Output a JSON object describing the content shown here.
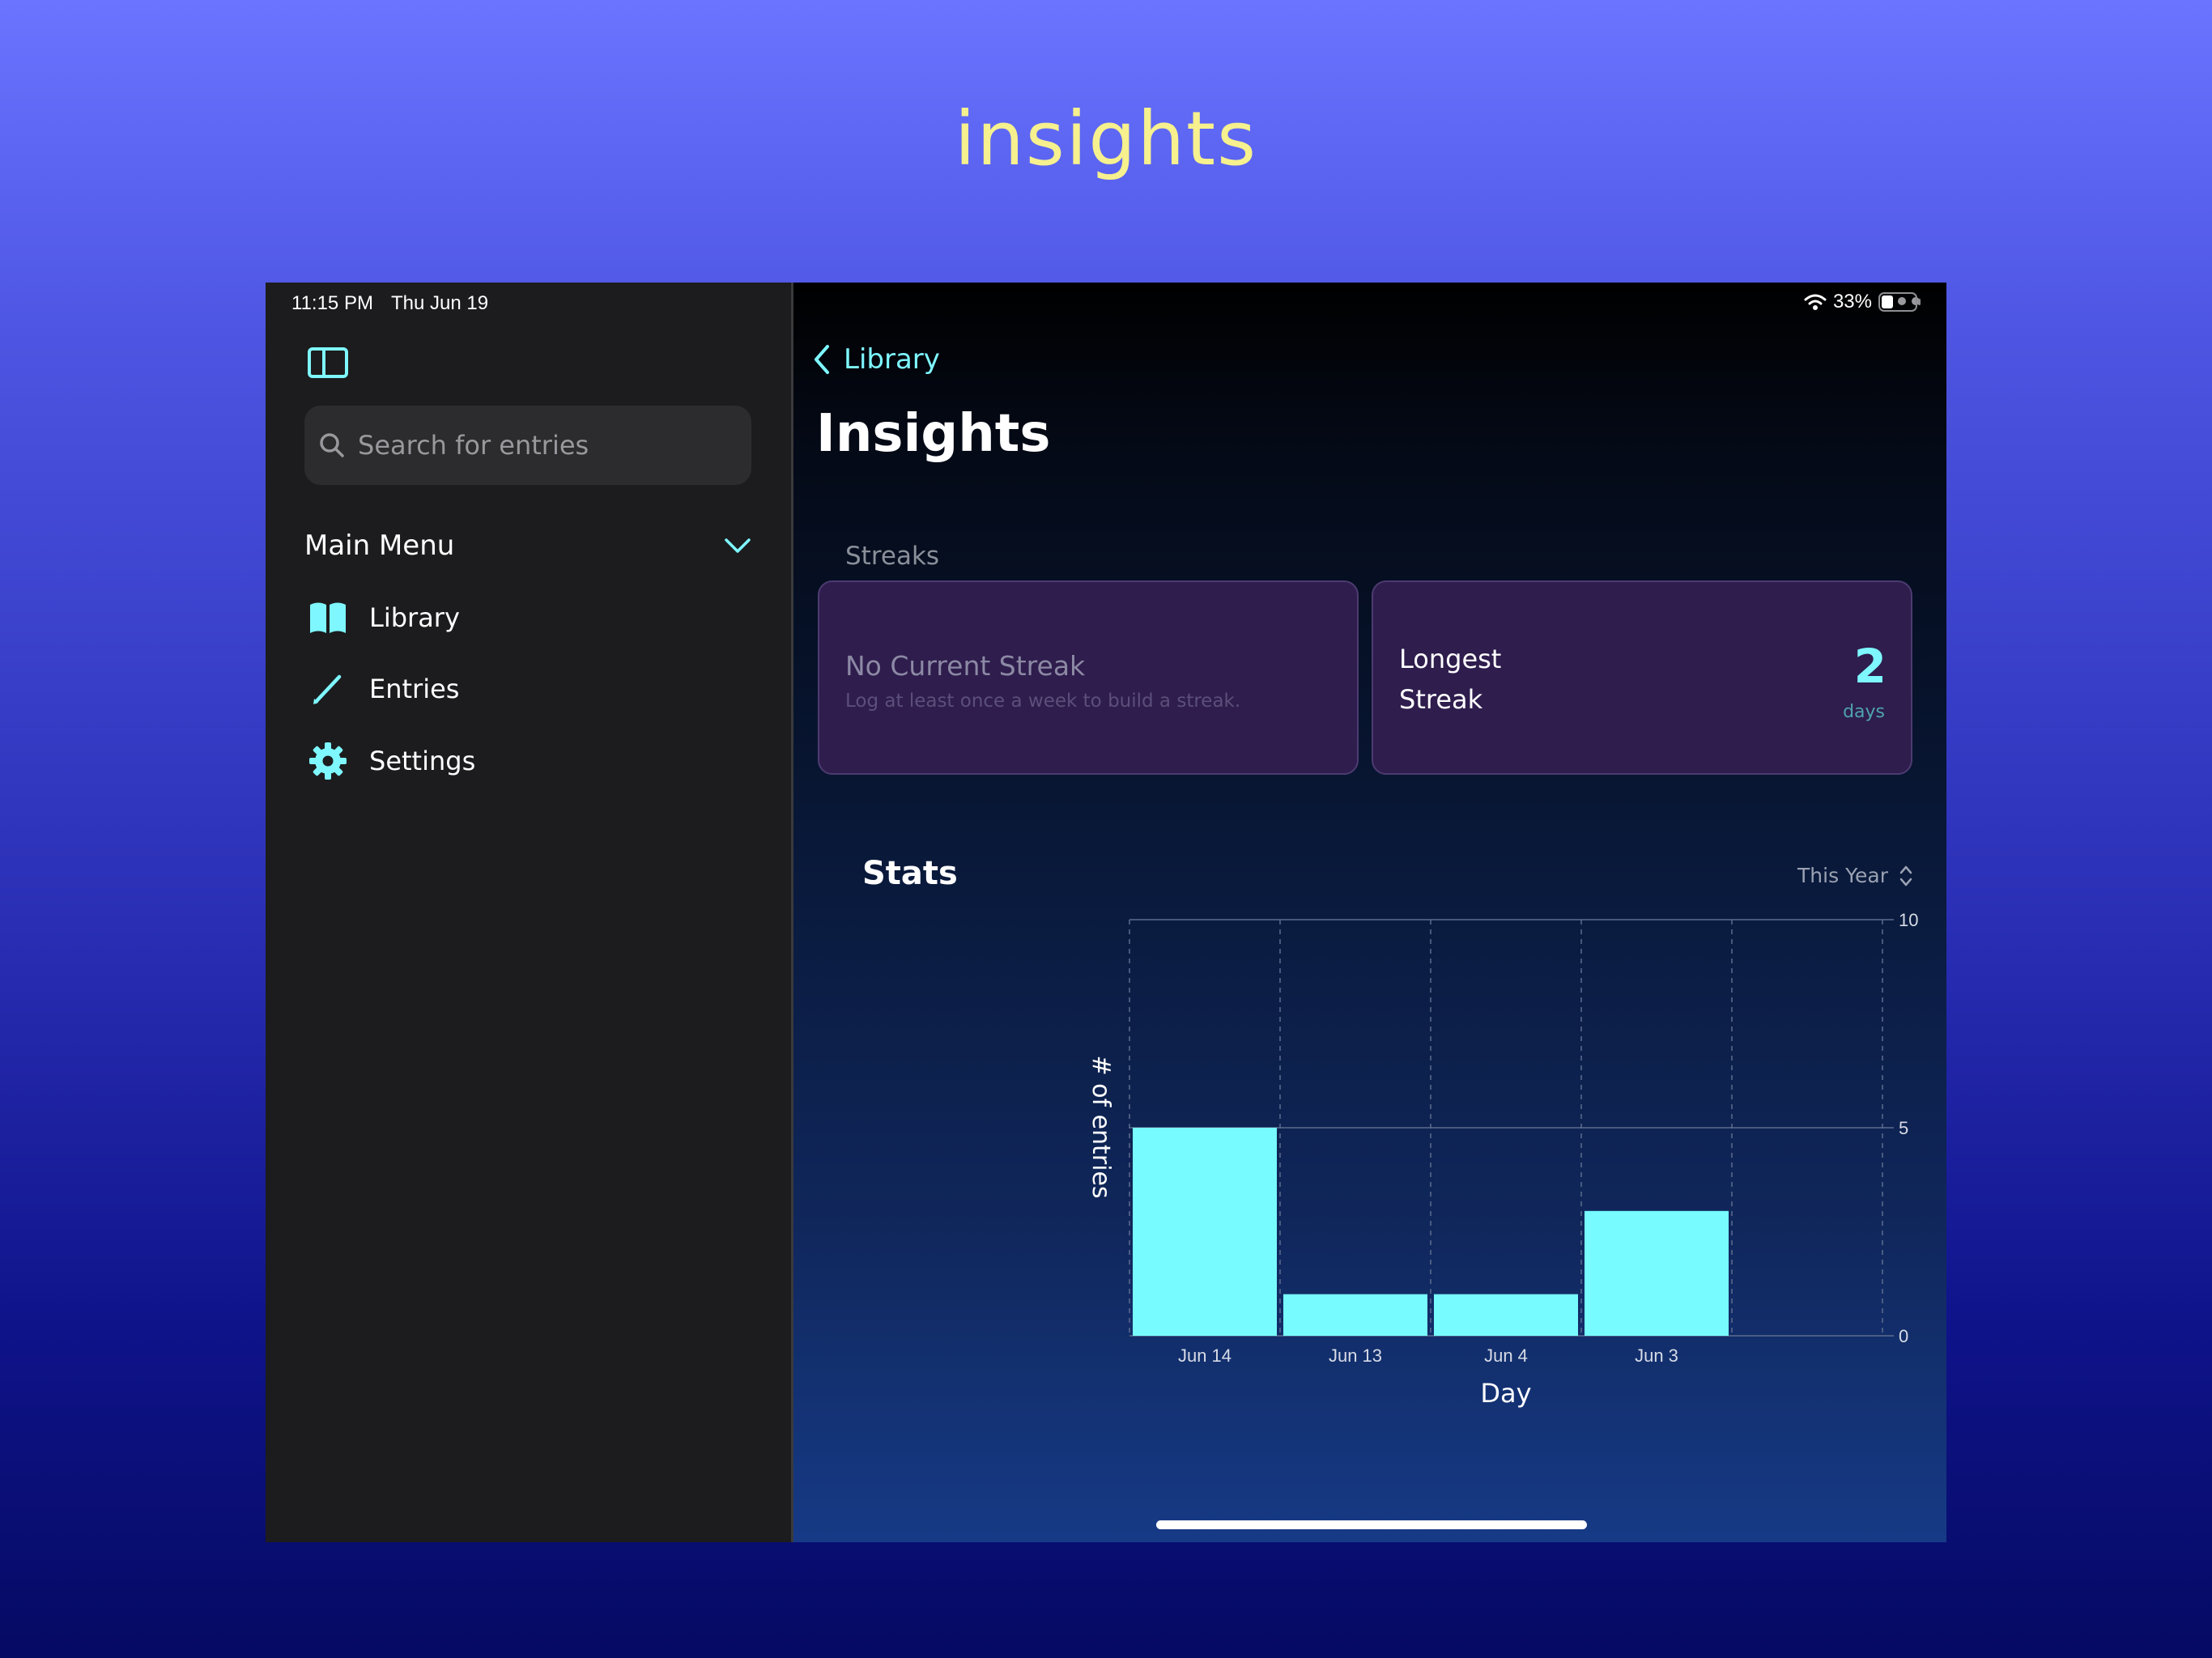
{
  "promo": {
    "title": "insights"
  },
  "status_bar": {
    "time": "11:15 PM",
    "date": "Thu Jun 19",
    "battery": "33%"
  },
  "sidebar": {
    "search": {
      "placeholder": "Search for entries",
      "value": ""
    },
    "menu_header": "Main Menu",
    "items": [
      {
        "label": "Library",
        "icon": "book-icon"
      },
      {
        "label": "Entries",
        "icon": "pencil-icon"
      },
      {
        "label": "Settings",
        "icon": "gear-icon"
      }
    ]
  },
  "main": {
    "back_label": "Library",
    "title": "Insights",
    "streaks_label": "Streaks",
    "current_streak": {
      "title": "No Current Streak",
      "subtitle": "Log at least once a week to build a streak."
    },
    "longest_streak": {
      "line1": "Longest",
      "line2": "Streak",
      "value": "2",
      "unit": "days"
    },
    "stats_title": "Stats",
    "range_picker": "This Year"
  },
  "chart_data": {
    "type": "bar",
    "categories": [
      "Jun 14",
      "Jun 13",
      "Jun 4",
      "Jun 3"
    ],
    "values": [
      5,
      1,
      1,
      3
    ],
    "xlabel": "Day",
    "ylabel": "# of entries",
    "ylim": [
      0,
      10
    ],
    "yticks": [
      0,
      5,
      10
    ],
    "grid": true
  },
  "colors": {
    "accent": "#7ef7ff",
    "bar": "#77fbff",
    "card_bg": "#2e1d4d",
    "promo_title": "#f6f08e",
    "sidebar_bg": "#1c1c1e"
  }
}
